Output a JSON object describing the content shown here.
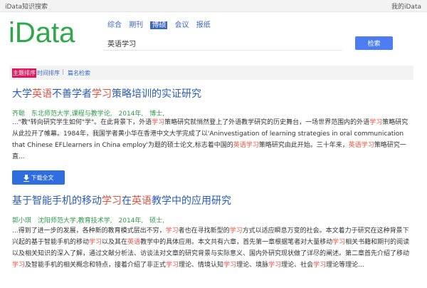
{
  "topbar": {
    "site": "iData知识搜索",
    "mine": "我的iData"
  },
  "logo": "iData",
  "categories": [
    "综合",
    "期刊",
    "博硕",
    "会议",
    "报纸"
  ],
  "active_category_index": 2,
  "search": {
    "value": "英语学习",
    "button": "检索"
  },
  "sort": {
    "items": [
      "主题排序",
      "时间排序",
      "篇名检索"
    ],
    "active_index": 0
  },
  "results": [
    {
      "title": [
        [
          "大学",
          false
        ],
        [
          "英语",
          true
        ],
        [
          "不善学者",
          false
        ],
        [
          "学习",
          true
        ],
        [
          "策略培训的实证研究",
          false
        ]
      ],
      "author": "齐聪",
      "source": "东北师范大学,课程与教学论,",
      "year": "2014年,",
      "degree": "博士,",
      "abstract": [
        [
          "...\"教\"转向研究学生如何\"学\"。在此背景下，外语",
          false
        ],
        [
          "学习",
          true
        ],
        [
          "策略研究就悄然登上了外语教学研究的历史舞台，一场世界范围内的外语",
          false
        ],
        [
          "学习",
          true
        ],
        [
          "策略研究从此拉开了帷幕。1984年，我国学者黄小华在香港中文大学完成了以'Aninvestigation of learning strategies in oral communication that Chinese EFLlearners in China employ'为题的硕士论文,标志着中国的",
          false
        ],
        [
          "英语学习",
          true
        ],
        [
          "策略研究由此开始。三十年来，",
          false
        ],
        [
          "英语学习",
          true
        ],
        [
          "策略研究一直...",
          false
        ]
      ],
      "download": "下载全文"
    },
    {
      "title": [
        [
          "基于智能手机的移动",
          false
        ],
        [
          "学习",
          true
        ],
        [
          "在",
          false
        ],
        [
          "英语",
          true
        ],
        [
          "教学中的应用研究",
          false
        ]
      ],
      "author": "郭小琪",
      "source": "沈阳师范大学,教育技术学,",
      "year": "2014年,",
      "degree": "硕士,",
      "abstract": [
        [
          "...得到了进一步的发展，各种新的教育模式层出不穷，",
          false
        ],
        [
          "学习",
          true
        ],
        [
          "者也在寻找新型的",
          false
        ],
        [
          "学习",
          true
        ],
        [
          "方式以适应瞬息万变的社会。本文着力于研究在这种背景下兴起的基于智能手机的移动",
          false
        ],
        [
          "学习",
          true
        ],
        [
          "以及其在",
          false
        ],
        [
          "英语",
          true
        ],
        [
          "教学中的具体应用。本文共有六章，首先第一章根据笔者对大量移动",
          false
        ],
        [
          "学习",
          true
        ],
        [
          "相关书籍和期刊的阅读以及相关知识的深入了解，通过文献分析法、访谈法对文章的研究背景与实际意义、国内外研究现状做了详尽的阐述。第二章首先介绍了移动",
          false
        ],
        [
          "学习",
          true
        ],
        [
          "及智能手机的相关概念和特点，接着介绍了非正式",
          false
        ],
        [
          "学习",
          true
        ],
        [
          "理论、情境认知",
          false
        ],
        [
          "学习",
          true
        ],
        [
          "理论、境脉",
          false
        ],
        [
          "学习",
          true
        ],
        [
          "理论、社会",
          false
        ],
        [
          "学习",
          true
        ],
        [
          "理论等理论...",
          false
        ]
      ]
    }
  ]
}
